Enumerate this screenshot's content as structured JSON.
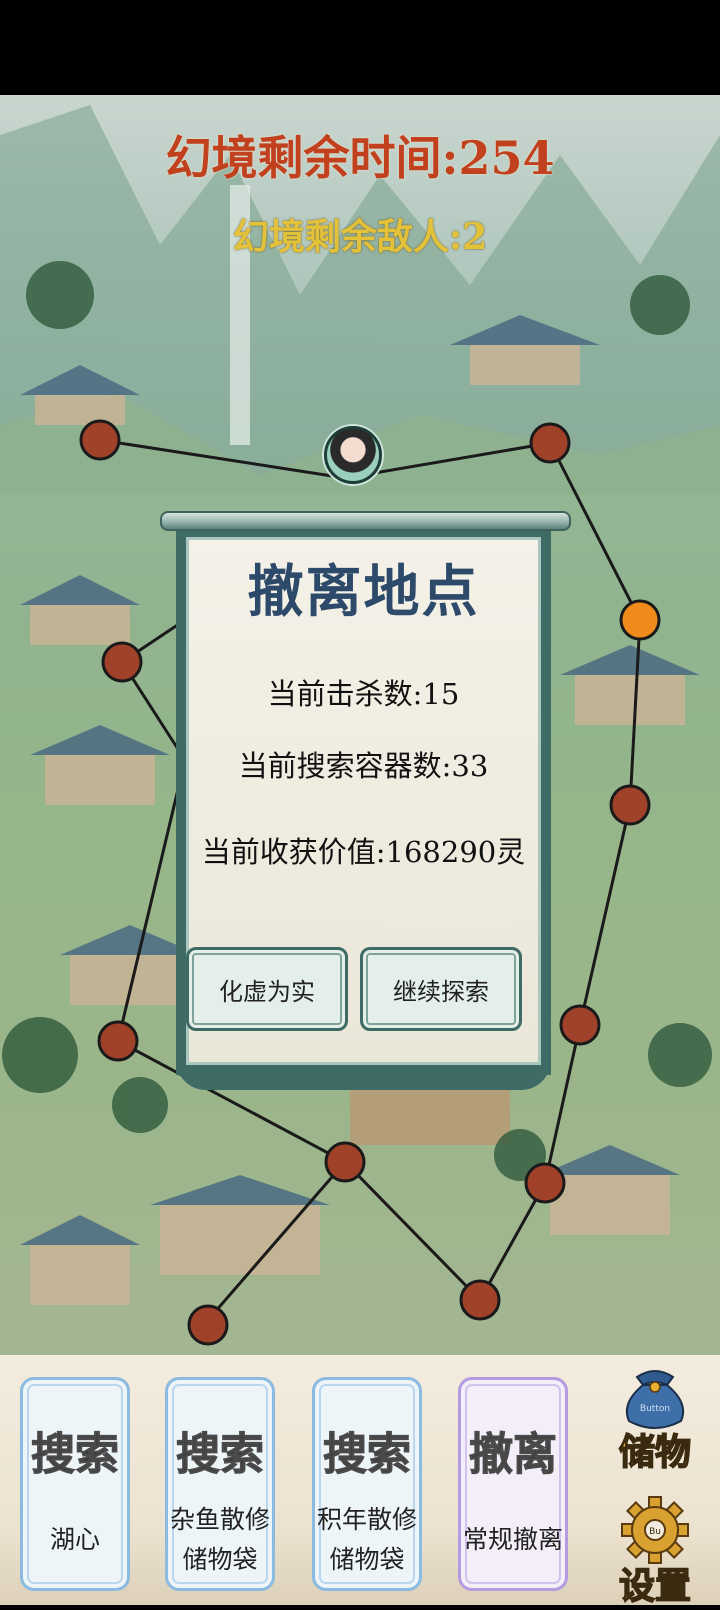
{
  "hud": {
    "timer_text": "幻境剩余时间:254",
    "enemies_text": "幻境剩余敌人:2"
  },
  "dialog": {
    "title": "撤离地点",
    "kills": "当前击杀数:15",
    "containers": "当前搜索容器数:33",
    "value": "当前收获价值:168290灵",
    "confirm_label": "化虚为实",
    "continue_label": "继续探索"
  },
  "actions": [
    {
      "title": "搜索",
      "sub": "湖心",
      "color": "#8bbbe0"
    },
    {
      "title": "搜索",
      "sub1": "杂鱼散修",
      "sub2": "储物袋",
      "color": "#8bbbe0"
    },
    {
      "title": "搜索",
      "sub1": "积年散修",
      "sub2": "储物袋",
      "color": "#8bbbe0"
    },
    {
      "title": "撤离",
      "sub": "常规撤离",
      "color": "#b59be0"
    }
  ],
  "side": {
    "storage_label": "储物",
    "storage_icon_text": "Button",
    "settings_label": "设置",
    "settings_icon_text": "Bu"
  },
  "colors": {
    "node": "#a0412a",
    "node_active": "#f08a1a",
    "timer": "#c1401e",
    "enemies": "#e3c23a",
    "dialog_border": "#3e6b66",
    "dialog_title": "#2d4a6b"
  }
}
